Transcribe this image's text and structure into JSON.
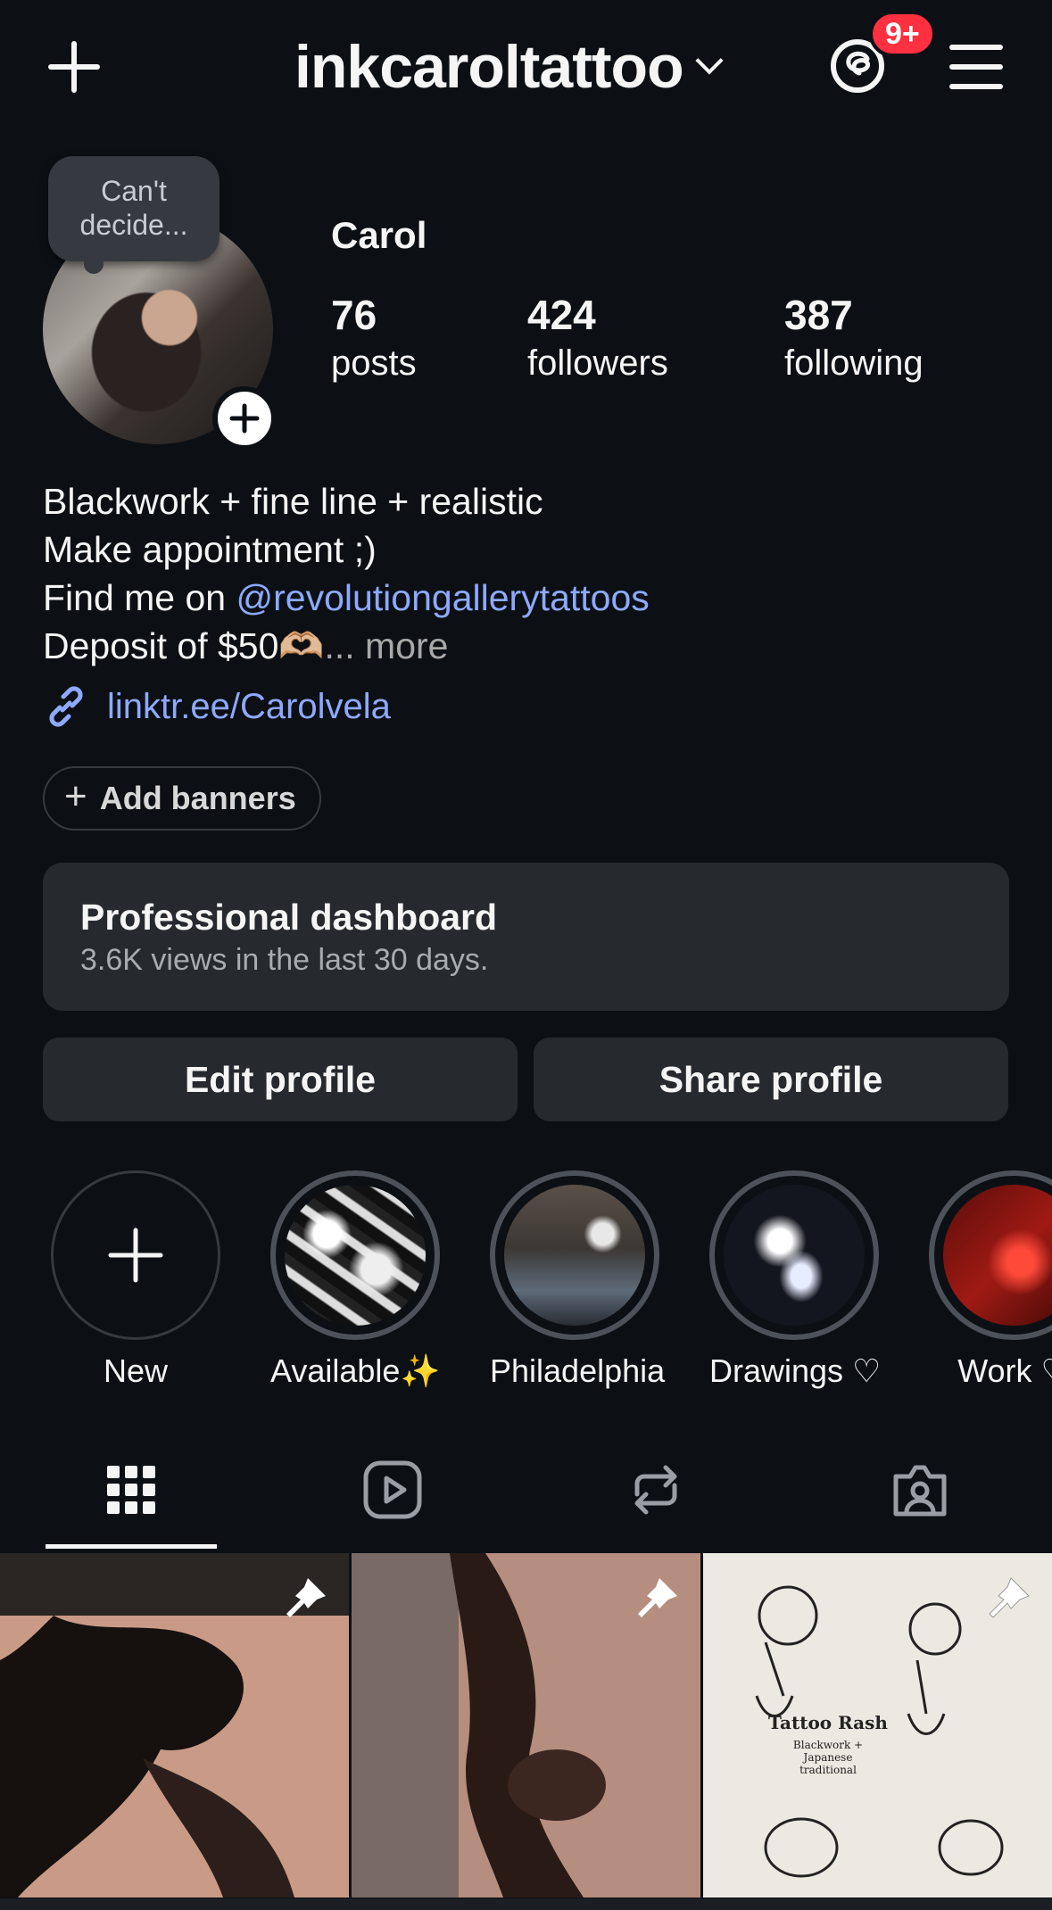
{
  "header": {
    "username": "inkcaroltattoo",
    "notification_badge": "9+"
  },
  "profile": {
    "note": "Can't decide...",
    "name": "Carol",
    "stats": [
      {
        "value": "76",
        "label": "posts"
      },
      {
        "value": "424",
        "label": "followers"
      },
      {
        "value": "387",
        "label": "following"
      }
    ],
    "bio": {
      "line1": "Blackwork + fine line + realistic",
      "line2": "Make appointment ;)",
      "line3_prefix": "Find me on ",
      "line3_mention": "@revolutiongallerytattoos",
      "line4": "Deposit of $50🫶🏼",
      "line4_ellipsis": "...",
      "more": "more"
    },
    "link": "linktr.ee/Carolvela",
    "add_banners": "Add banners"
  },
  "dashboard": {
    "title": "Professional dashboard",
    "subtitle": "3.6K views in the last 30 days."
  },
  "actions": {
    "edit": "Edit profile",
    "share": "Share profile"
  },
  "highlights": [
    {
      "label": "New"
    },
    {
      "label": "Available✨"
    },
    {
      "label": "Philadelphia"
    },
    {
      "label": "Drawings ♡"
    },
    {
      "label": "Work ♡"
    }
  ],
  "tabs": [
    "grid-icon",
    "reels-icon",
    "reposts-icon",
    "tagged-icon"
  ],
  "grid": {
    "tile3_text": {
      "title": "Tattoo Rash",
      "line1": "Blackwork +",
      "line2": "Japanese",
      "line3": "traditional"
    }
  },
  "colors": {
    "background": "#0c1014",
    "accent_link": "#8ea9ff",
    "badge": "#ff3040",
    "card": "#262a2f"
  }
}
